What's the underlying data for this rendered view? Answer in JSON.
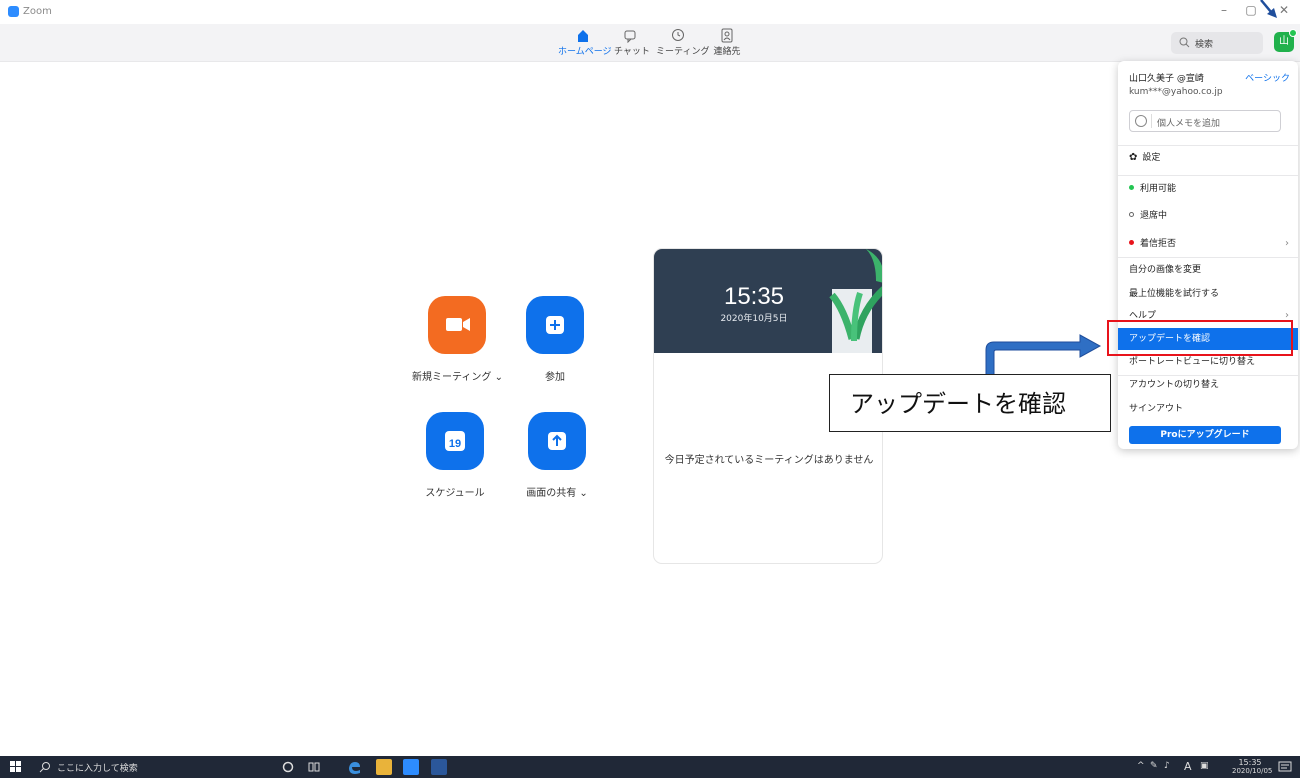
{
  "window": {
    "title": "Zoom",
    "minimize": "–",
    "restore": "▢",
    "close": "✕"
  },
  "nav": {
    "tabs": [
      {
        "label": "ホームページ",
        "icon": "home-icon",
        "active": true
      },
      {
        "label": "チャット",
        "icon": "chat-icon",
        "active": false
      },
      {
        "label": "ミーティング",
        "icon": "clock-icon",
        "active": false
      },
      {
        "label": "連絡先",
        "icon": "contacts-icon",
        "active": false
      }
    ],
    "search_label": "検索",
    "avatar_letter": "山"
  },
  "actions": [
    {
      "label": "新規ミーティング ⌄",
      "icon": "video-camera-icon",
      "color": "#f36b21"
    },
    {
      "label": "参加",
      "icon": "plus-icon",
      "color": "#0e71eb"
    },
    {
      "label": "スケジュール",
      "icon": "calendar-icon",
      "color": "#0e71eb",
      "calendar_day": "19"
    },
    {
      "label": "画面の共有 ⌄",
      "icon": "share-up-arrow-icon",
      "color": "#0e71eb"
    }
  ],
  "meeting_card": {
    "time": "15:35",
    "date": "2020年10月5日",
    "empty_message": "今日予定されているミーティングはありません"
  },
  "menu": {
    "user_name": "山口久美子 @宣崎",
    "plan": "ベーシック",
    "email": "kum***@yahoo.co.jp",
    "note_placeholder": "個人メモを追加",
    "settings": "設定",
    "statuses": [
      {
        "label": "利用可能",
        "color": "#23c552"
      },
      {
        "label": "退席中",
        "color": "#ffffff"
      },
      {
        "label": "着信拒否",
        "color": "#e8131b"
      }
    ],
    "items": [
      "自分の画像を変更",
      "最上位機能を試行する",
      "ヘルプ",
      "アップデートを確認",
      "ポートレートビューに切り替え",
      "アカウントの切り替え",
      "サインアウト"
    ],
    "upgrade_button": "Proにアップグレード"
  },
  "callout": {
    "text": "アップデートを確認"
  },
  "taskbar": {
    "search_placeholder": "ここに入力して検索",
    "clock_time": "15:35",
    "clock_date": "2020/10/05",
    "ime": "A"
  }
}
